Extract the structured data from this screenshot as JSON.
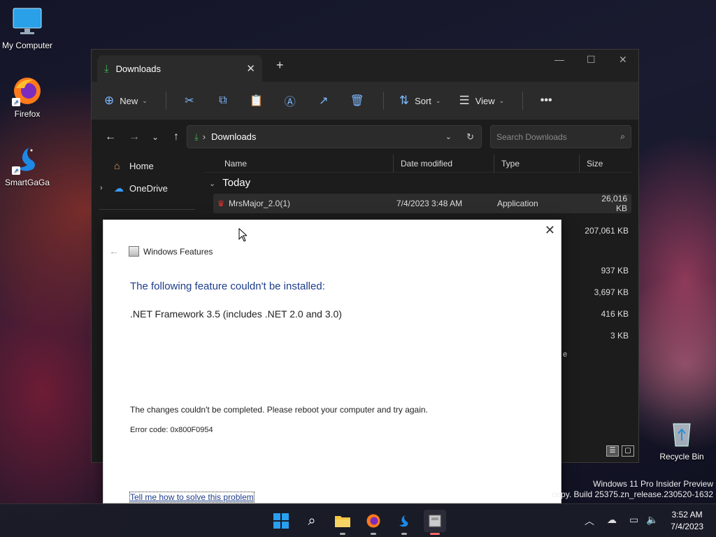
{
  "desktop": {
    "icons": [
      {
        "label": "My Computer"
      },
      {
        "label": "Firefox"
      },
      {
        "label": "SmartGaGa"
      },
      {
        "label": "Recycle Bin"
      }
    ],
    "watermark": {
      "line1": "Windows 11 Pro Insider Preview",
      "line2": "copy. Build 25375.zn_release.230520-1632"
    }
  },
  "explorer": {
    "tab_title": "Downloads",
    "toolbar": {
      "new_label": "New",
      "sort_label": "Sort",
      "view_label": "View"
    },
    "address": {
      "path": "Downloads",
      "search_placeholder": "Search Downloads"
    },
    "sidebar": {
      "items": [
        {
          "label": "Home"
        },
        {
          "label": "OneDrive"
        }
      ]
    },
    "columns": {
      "name": "Name",
      "date": "Date modified",
      "type": "Type",
      "size": "Size"
    },
    "group": "Today",
    "rows": [
      {
        "name": "MrsMajor_2.0(1)",
        "date": "7/4/2023 3:48 AM",
        "type": "Application",
        "size": "26,016 KB"
      }
    ],
    "hidden_sizes": [
      "207,061 KB",
      "937 KB",
      "3,697 KB",
      "416 KB",
      "3 KB"
    ],
    "hidden_type_fragment": "e"
  },
  "dialog": {
    "title": "Windows Features",
    "heading": "The following feature couldn't be installed:",
    "feature": ".NET Framework 3.5 (includes .NET 2.0 and 3.0)",
    "message": "The changes couldn't be completed. Please reboot your computer and try again.",
    "error_code": "Error code: 0x800F0954",
    "help_link": "Tell me how to solve this problem"
  },
  "taskbar": {
    "clock_time": "3:52 AM",
    "clock_date": "7/4/2023"
  },
  "colors": {
    "accent_blue": "#1e3d8c",
    "download_green": "#3fb950",
    "explorer_bg": "#1c1c1c"
  }
}
